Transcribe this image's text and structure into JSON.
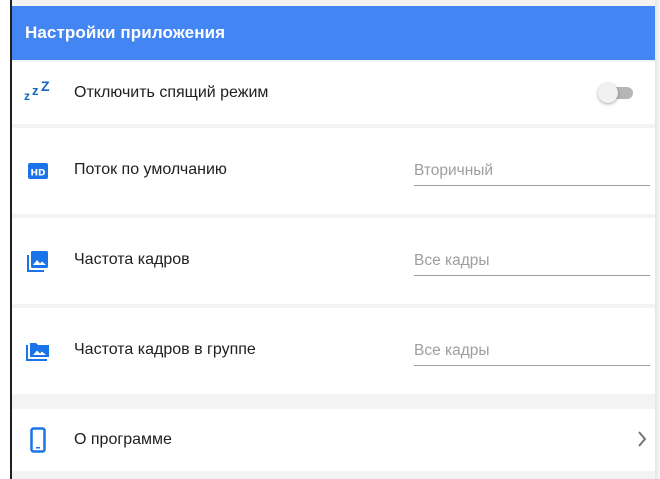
{
  "header": {
    "title": "Настройки приложения"
  },
  "settings": {
    "sleep": {
      "label": "Отключить спящий режим",
      "icon": "sleep-zzz-icon",
      "enabled": false
    },
    "default_stream": {
      "label": "Поток по умолчанию",
      "icon": "hd-icon",
      "value": "Вторичный",
      "icon_text": "HD"
    },
    "frame_rate": {
      "label": "Частота кадров",
      "icon": "photo-library-icon",
      "value": "Все кадры"
    },
    "group_frame_rate": {
      "label": "Частота кадров в группе",
      "icon": "photo-library-icon",
      "value": "Все кадры"
    },
    "about": {
      "label": "О программе",
      "icon": "phone-icon"
    }
  },
  "colors": {
    "accent": "#4386f3",
    "icon": "#1a73e8",
    "toggle_off": "#b6b6b6"
  }
}
